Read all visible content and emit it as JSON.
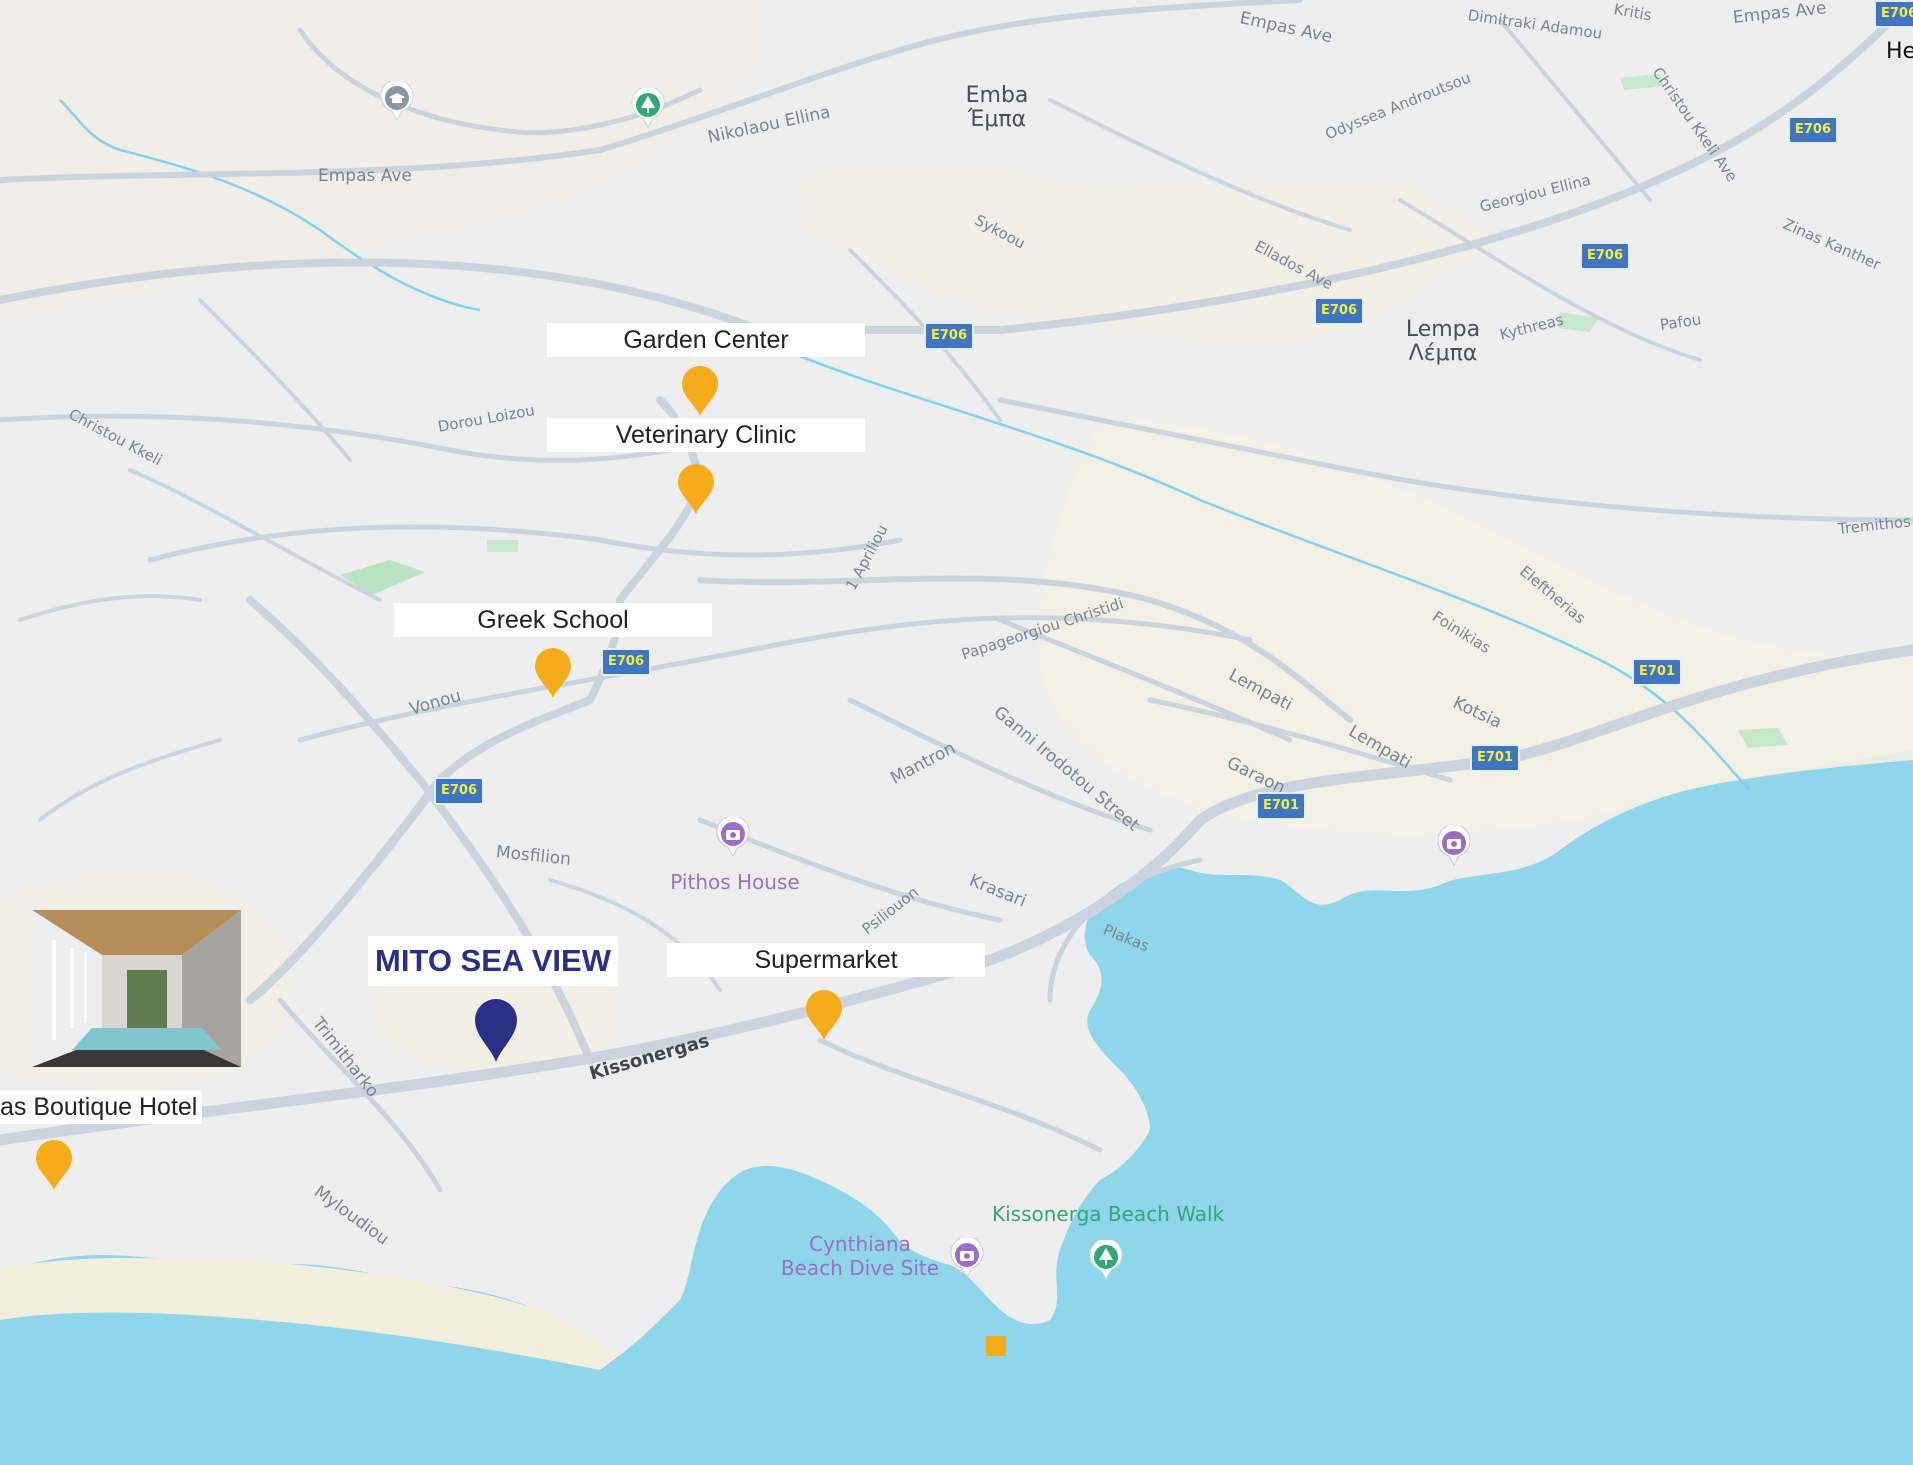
{
  "map": {
    "colors": {
      "land": "#eeeeef",
      "land_tint": "#f3efe4",
      "sea": "#8fd6ea",
      "road": "#c9d2dc",
      "river": "#7fd3ef",
      "park": "#b9e3c2",
      "pin_amenity": "#f5ac1b",
      "pin_property": "#2b3087",
      "poi_purple": "#9b6fc5",
      "poi_green": "#30a878",
      "shield_bg": "#3f76c4",
      "shield_text": "#f6ee3c"
    },
    "property": {
      "label": "MITO SEA VIEW",
      "pin_icon": "location-pin-icon"
    },
    "amenities": [
      {
        "label": "Garden Center",
        "pin_icon": "location-pin-icon"
      },
      {
        "label": "Veterinary Clinic",
        "pin_icon": "location-pin-icon"
      },
      {
        "label": "Greek School",
        "pin_icon": "location-pin-icon"
      },
      {
        "label": "Supermarket",
        "pin_icon": "location-pin-icon"
      },
      {
        "label": "as Boutique Hotel",
        "pin_icon": "location-pin-icon"
      }
    ],
    "places": [
      {
        "name": "Emba",
        "name_local": "Έμπα"
      },
      {
        "name": "Lempa",
        "name_local": "Λέμπα"
      },
      {
        "name": "He"
      }
    ],
    "pois": [
      {
        "name": "Pithos House",
        "icon": "camera-icon"
      },
      {
        "name": "Cynthiana\nBeach Dive Site",
        "icon": "camera-icon"
      },
      {
        "name": "Kissonerga Beach Walk",
        "icon": "tree-icon"
      },
      {
        "name": "",
        "icon": "camera-icon"
      },
      {
        "name": "",
        "icon": "tree-icon"
      },
      {
        "name": "",
        "icon": "school-icon"
      }
    ],
    "streets": [
      "Empas Ave",
      "Empas Ave",
      "Empas Ave",
      "Dimitraki Adamou",
      "Kritis",
      "Nikolaou Ellina",
      "Odyssea Androutsou",
      "Christou Kkeli Ave",
      "Sykoou",
      "Georgiou Ellina",
      "Ellados Ave",
      "Zinas Kanther",
      "Kythreas",
      "Pafou",
      "Dorou Loizou",
      "Christou Kkeli",
      "1 Apriliou",
      "Papageorgiou Christidi",
      "Tremithos",
      "Eleftherias",
      "Foinikias",
      "Kotsia",
      "Lempati",
      "Lempati",
      "Garaon",
      "Vonou",
      "Ganni Irodotou Street",
      "Mantron",
      "Mosfilion",
      "Krasari",
      "Psiliouon",
      "Plakas",
      "Trimitharko",
      "Kissonergas",
      "Myloudiou"
    ],
    "shields": [
      "E706",
      "E706",
      "E706",
      "E706",
      "E706",
      "E706",
      "E706",
      "E701",
      "E701",
      "E701"
    ]
  }
}
